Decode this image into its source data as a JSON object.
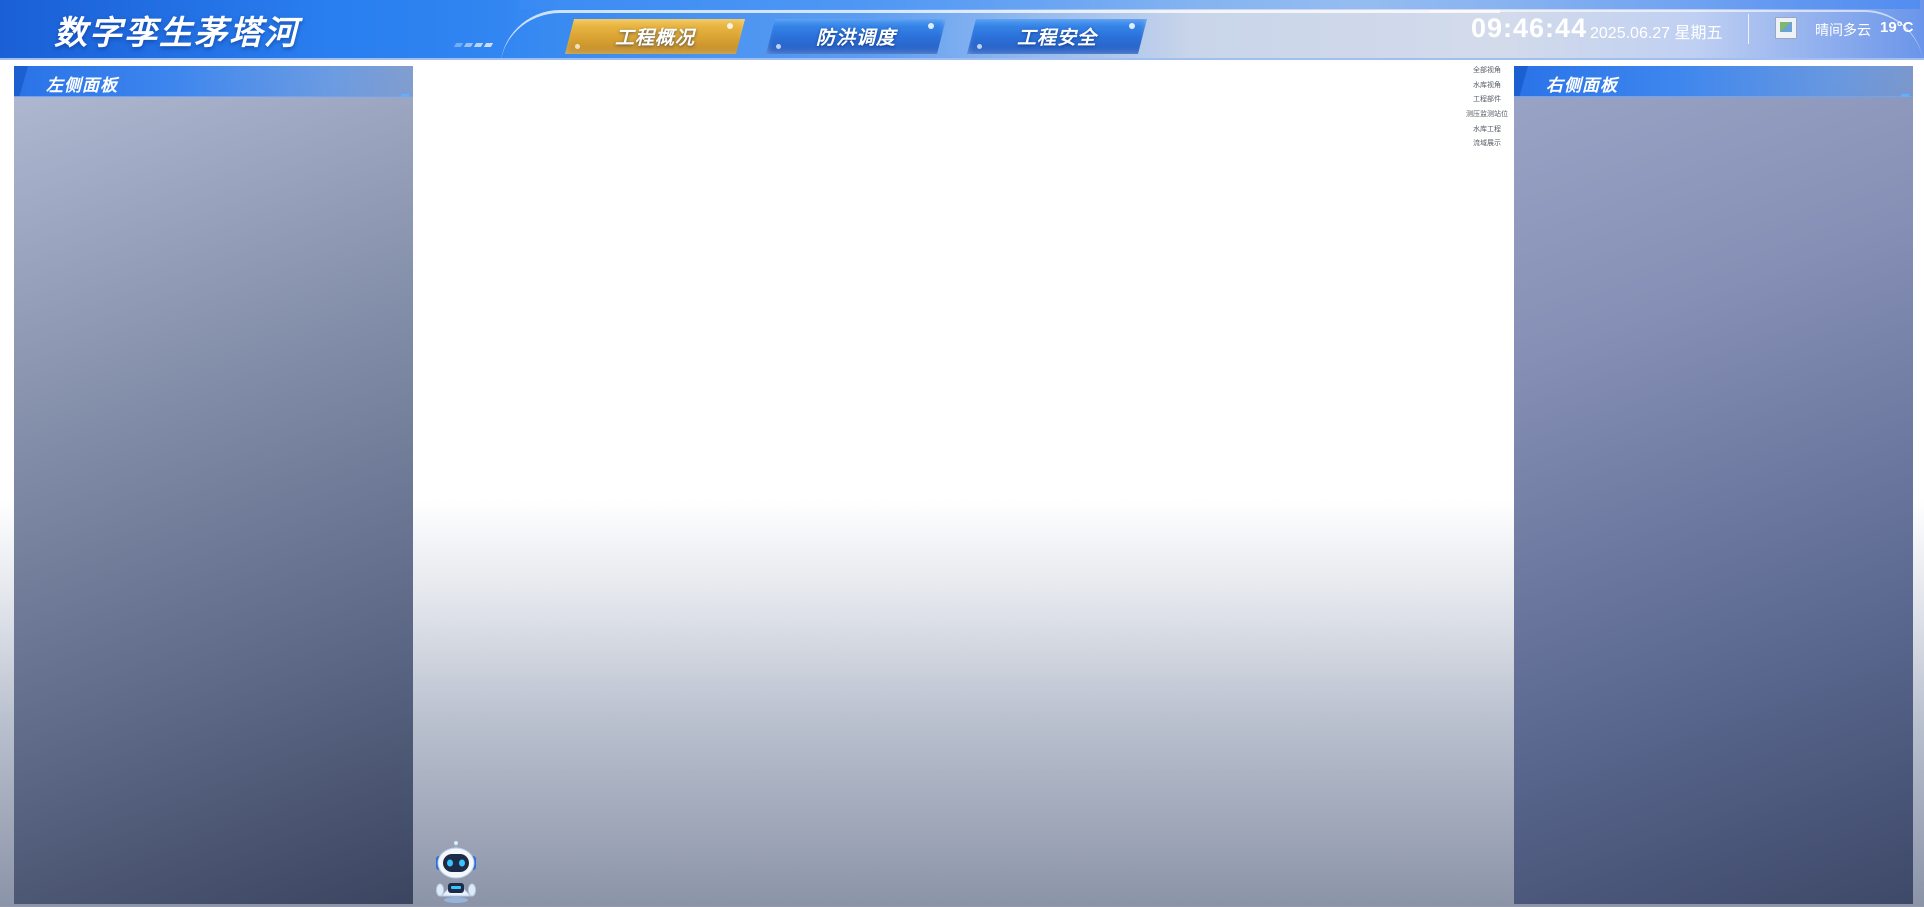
{
  "header": {
    "app_title": "数字孪生茅塔河",
    "nav_tabs": [
      {
        "label": "工程概况",
        "active": true
      },
      {
        "label": "防洪调度",
        "active": false
      },
      {
        "label": "工程安全",
        "active": false
      }
    ],
    "clock": "09:46:44",
    "date": "2025.06.27 星期五",
    "weather": {
      "icon": "broken-image-icon",
      "condition": "晴间多云",
      "temperature": "19°C"
    }
  },
  "left_panel": {
    "title": "左侧面板"
  },
  "right_panel": {
    "title": "右侧面板"
  },
  "map": {
    "layers": [
      "全部视角",
      "水库视角",
      "工程部件",
      "测压监测站位",
      "水库工程",
      "流域展示"
    ]
  },
  "assistant": {
    "icon": "robot-assistant-icon"
  },
  "colors": {
    "active_tab": "#d9a232",
    "normal_tab": "#2a6fd8",
    "header_blue": "#2a7ff0",
    "panel_header": "#2a73e8"
  }
}
